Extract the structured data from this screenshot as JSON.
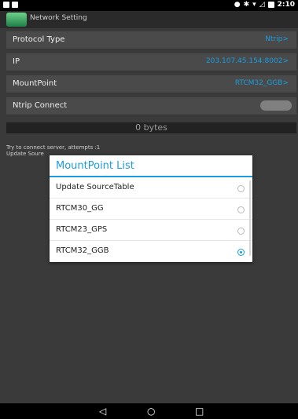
{
  "status_bar": {
    "time": "2:10"
  },
  "app": {
    "title": "Network Setting"
  },
  "settings": [
    {
      "label": "Protocol Type",
      "value": "Ntrip>"
    },
    {
      "label": "IP",
      "value": "203.107.45.154:8002>"
    },
    {
      "label": "MountPoint",
      "value": "RTCM32_GGB>"
    },
    {
      "label": "Ntrip Connect",
      "value": ""
    }
  ],
  "bytes_label": "0 bytes",
  "log": {
    "line1": "Try to connect server, attempts :1",
    "line2": "Update Soure"
  },
  "dialog": {
    "title": "MountPoint List",
    "items": [
      {
        "label": "Update SourceTable",
        "checked": false
      },
      {
        "label": "RTCM30_GG",
        "checked": false
      },
      {
        "label": "RTCM23_GPS",
        "checked": false
      },
      {
        "label": "RTCM32_GGB",
        "checked": true
      }
    ]
  },
  "nav": {
    "back_icon": "◁",
    "home_icon": "○",
    "recent_icon": "□"
  },
  "colors": {
    "accent": "#1a9de0",
    "background": "#3a3a3a",
    "dialog_bg": "#ffffff"
  }
}
